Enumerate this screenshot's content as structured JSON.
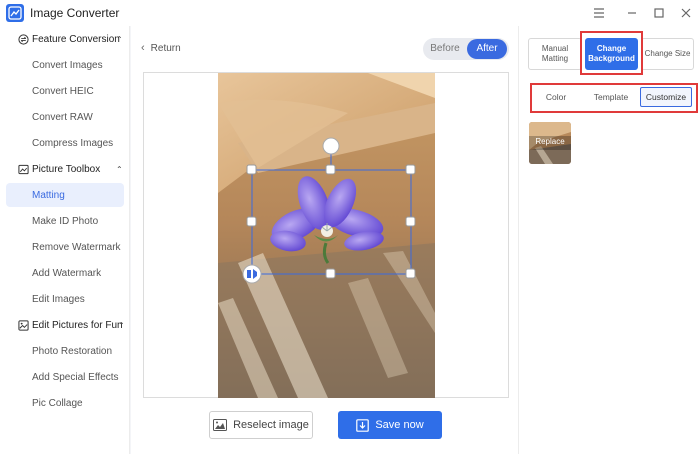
{
  "app": {
    "title": "Image Converter"
  },
  "window": {
    "menu_icon": "hamburger-icon",
    "minimize_icon": "minimize-icon",
    "maximize_icon": "maximize-icon",
    "close_icon": "close-icon"
  },
  "sidebar": {
    "sections": [
      {
        "label": "Feature Conversion",
        "icon": "convert-icon",
        "items": [
          "Convert Images",
          "Convert HEIC",
          "Convert RAW",
          "Compress Images"
        ]
      },
      {
        "label": "Picture Toolbox",
        "icon": "toolbox-icon",
        "items": [
          "Matting",
          "Make ID Photo",
          "Remove Watermark",
          "Add Watermark",
          "Edit Images"
        ]
      },
      {
        "label": "Edit Pictures for Fun",
        "icon": "picture-edit-icon",
        "items": [
          "Photo Restoration",
          "Add Special Effects",
          "Pic Collage"
        ]
      }
    ],
    "active_item": "Matting"
  },
  "center": {
    "return_label": "Return",
    "toggle": {
      "before": "Before",
      "after": "After",
      "selected": "After"
    },
    "reselect_label": "Reselect image",
    "save_label": "Save now"
  },
  "right": {
    "tabs": [
      "Manual Matting",
      "Change Background",
      "Change Size"
    ],
    "active_tab": "Change Background",
    "subtabs": [
      "Color",
      "Template",
      "Customize"
    ],
    "active_subtab": "Customize",
    "replace_label": "Replace"
  },
  "colors": {
    "accent": "#2f6ee8",
    "highlight": "#e03a3a",
    "active_bg": "#e9effd"
  }
}
